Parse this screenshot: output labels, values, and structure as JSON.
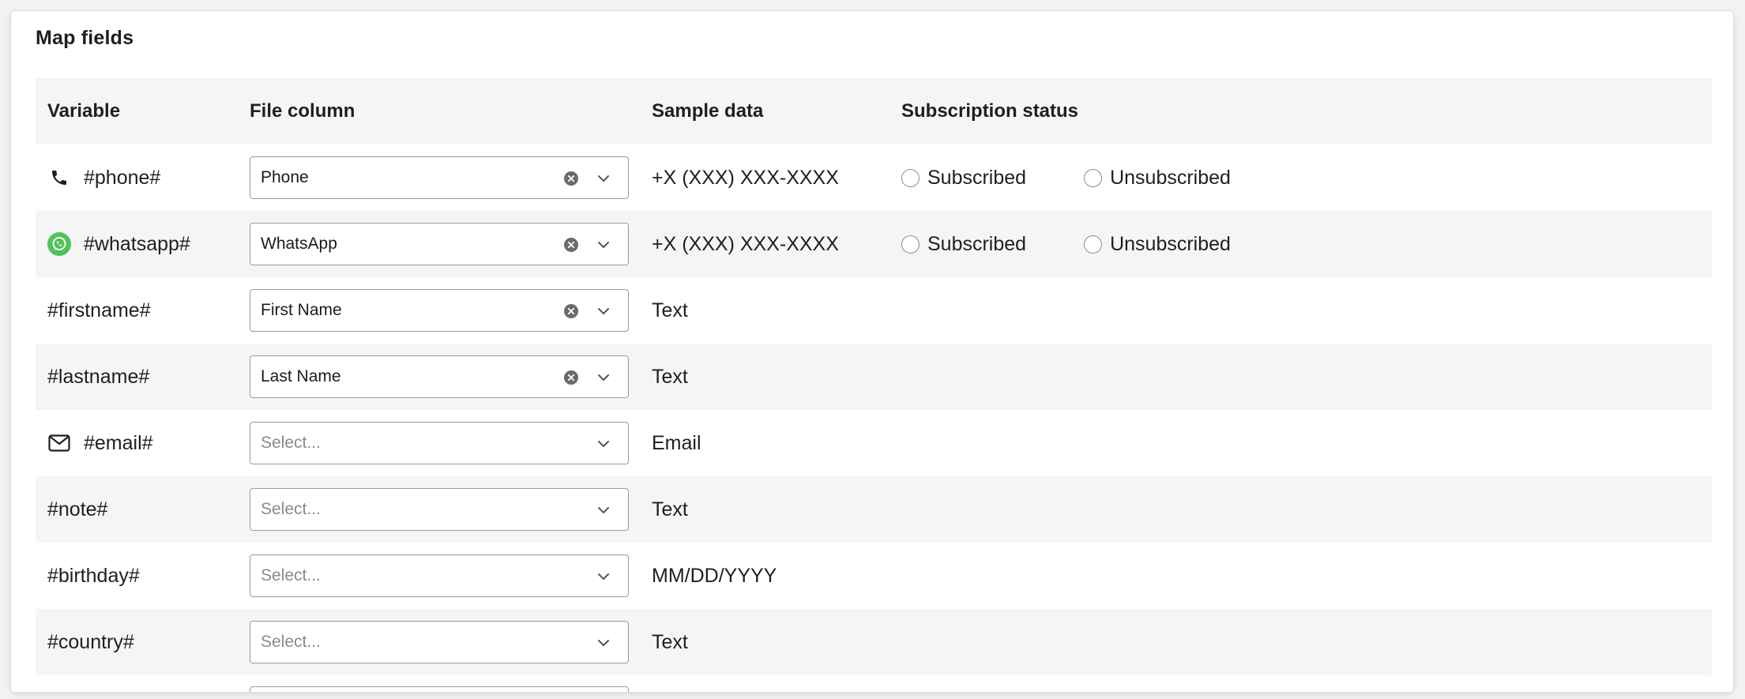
{
  "panel": {
    "title": "Map fields"
  },
  "table": {
    "headers": {
      "variable": "Variable",
      "file_column": "File column",
      "sample_data": "Sample data",
      "subscription_status": "Subscription status"
    },
    "rows": [
      {
        "variable": "#phone#",
        "icon": "phone-icon",
        "file_column": "Phone",
        "clearable": true,
        "sample": "+X (XXX) XXX-XXXX",
        "options": [
          "Subscribed",
          "Unsubscribed"
        ]
      },
      {
        "variable": "#whatsapp#",
        "icon": "whatsapp-icon",
        "file_column": "WhatsApp",
        "clearable": true,
        "sample": "+X (XXX) XXX-XXXX",
        "options": [
          "Subscribed",
          "Unsubscribed"
        ]
      },
      {
        "variable": "#firstname#",
        "icon": null,
        "file_column": "First Name",
        "clearable": true,
        "sample": "Text"
      },
      {
        "variable": "#lastname#",
        "icon": null,
        "file_column": "Last Name",
        "clearable": true,
        "sample": "Text"
      },
      {
        "variable": "#email#",
        "icon": "envelope-icon",
        "placeholder": "Select...",
        "sample": "Email"
      },
      {
        "variable": "#note#",
        "icon": null,
        "placeholder": "Select...",
        "sample": "Text"
      },
      {
        "variable": "#birthday#",
        "icon": null,
        "placeholder": "Select...",
        "sample": "MM/DD/YYYY"
      },
      {
        "variable": "#country#",
        "icon": null,
        "placeholder": "Select...",
        "sample": "Text"
      }
    ]
  },
  "colors": {
    "whatsapp_green": "#4fc35a",
    "shaded_row": "#f5f5f5"
  }
}
